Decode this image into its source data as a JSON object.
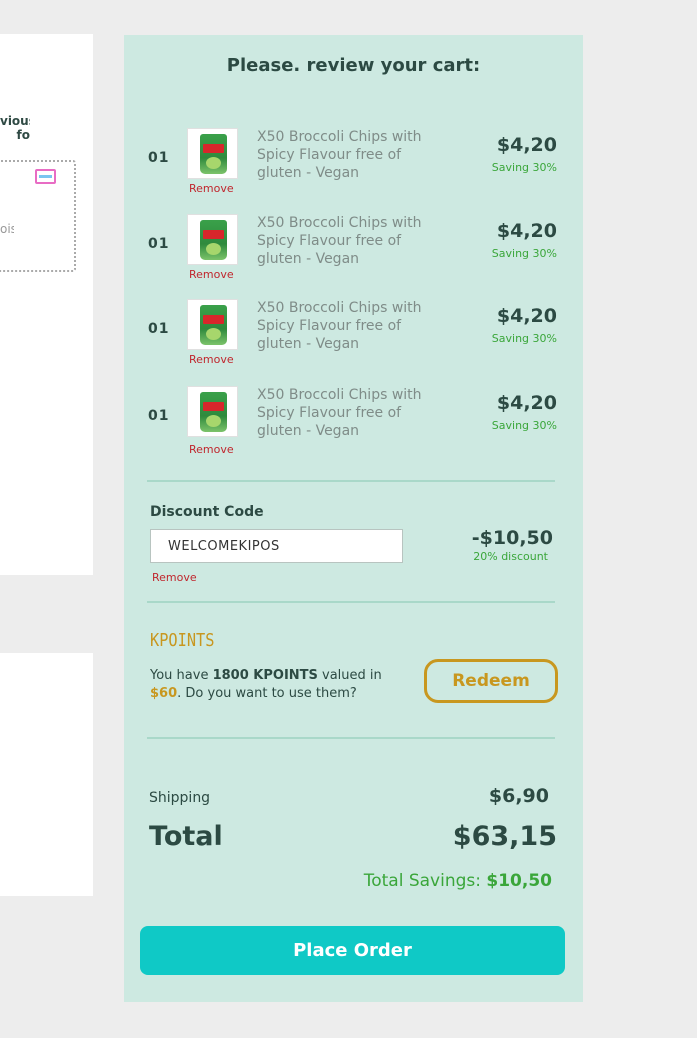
{
  "left_panel": {
    "label_line1": "vious",
    "label_line2": "fo",
    "box_text": "ois"
  },
  "cart": {
    "title": "Please. review your cart:",
    "items": [
      {
        "qty": "01",
        "name": "X50 Broccoli Chips with Spicy Flavour free of gluten - Vegan",
        "price": "$4,20",
        "saving": "Saving 30%",
        "remove": "Remove"
      },
      {
        "qty": "01",
        "name": "X50 Broccoli Chips with Spicy Flavour free of gluten - Vegan",
        "price": "$4,20",
        "saving": "Saving 30%",
        "remove": "Remove"
      },
      {
        "qty": "01",
        "name": "X50 Broccoli Chips with Spicy Flavour free of gluten - Vegan",
        "price": "$4,20",
        "saving": "Saving 30%",
        "remove": "Remove"
      },
      {
        "qty": "01",
        "name": "X50 Broccoli Chips with Spicy Flavour free of gluten - Vegan",
        "price": "$4,20",
        "saving": "Saving 30%",
        "remove": "Remove"
      }
    ],
    "discount": {
      "label": "Discount Code",
      "code": "WELCOMEKIPOS",
      "remove": "Remove",
      "amount": "-$10,50",
      "percent": "20% discount"
    },
    "kpoints": {
      "logo": "KPOINTS",
      "text_prefix": "You have ",
      "points": "1800 KPOINTS",
      "text_mid": " valued in ",
      "value": "$60",
      "text_suffix": ". Do you want to use them?",
      "redeem_label": "Redeem"
    },
    "summary": {
      "shipping_label": "Shipping",
      "shipping_value": "$6,90",
      "total_label": "Total",
      "total_value": "$63,15",
      "savings_label": "Total Savings: ",
      "savings_value": "$10,50"
    },
    "place_order_label": "Place Order"
  },
  "colors": {
    "panel_bg": "#cde9e1",
    "primary_text": "#2c4a43",
    "remove_red": "#c0262d",
    "saving_green": "#3aa63a",
    "kpoints_gold": "#c8971f",
    "cta_teal": "#0fc9c6"
  }
}
